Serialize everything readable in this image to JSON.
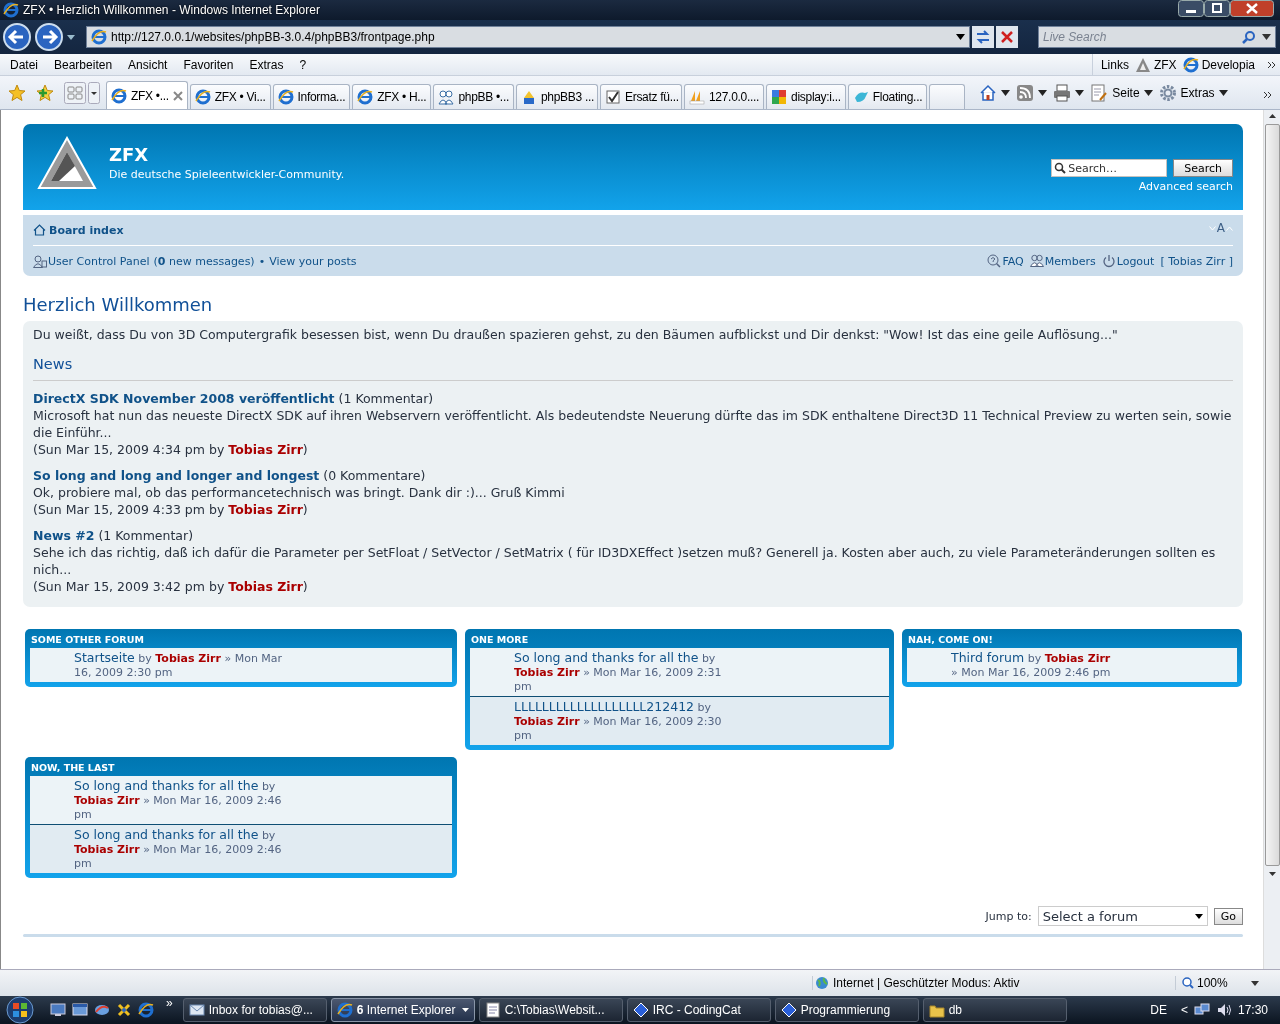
{
  "window": {
    "title": "ZFX • Herzlich Willkommen - Windows Internet Explorer"
  },
  "address": {
    "url": "http://127.0.0.1/websites/phpBB-3.0.4/phpBB3/frontpage.php"
  },
  "search": {
    "placeholder": "Live Search"
  },
  "menu": [
    "Datei",
    "Bearbeiten",
    "Ansicht",
    "Favoriten",
    "Extras",
    "?"
  ],
  "links_bar": {
    "label": "Links",
    "items": [
      {
        "kind": "zfx",
        "label": "ZFX"
      },
      {
        "kind": "ie",
        "label": "Developia"
      }
    ]
  },
  "tabs": [
    {
      "kind": "ie",
      "label": "ZFX •...",
      "selected": true
    },
    {
      "kind": "ie",
      "label": "ZFX • Vi...",
      "selected": false
    },
    {
      "kind": "ie",
      "label": "Informa...",
      "selected": false
    },
    {
      "kind": "ie",
      "label": "ZFX • H...",
      "selected": false
    },
    {
      "kind": "people",
      "label": "phpBB •...",
      "selected": false
    },
    {
      "kind": "hat",
      "label": "phpBB3 ...",
      "selected": false
    },
    {
      "kind": "check",
      "label": "Ersatz fü...",
      "selected": false
    },
    {
      "kind": "pma",
      "label": "127.0.0....",
      "selected": false
    },
    {
      "kind": "squares",
      "label": "display:i...",
      "selected": false
    },
    {
      "kind": "bird",
      "label": "Floating...",
      "selected": false
    }
  ],
  "commands": [
    {
      "kind": "home"
    },
    {
      "kind": "feeds"
    },
    {
      "kind": "print"
    },
    {
      "kind": "page",
      "label": "Seite"
    },
    {
      "kind": "tools",
      "label": "Extras"
    }
  ],
  "page": {
    "header": {
      "site": "ZFX",
      "tagline": "Die deutsche Spieleentwickler-Community.",
      "search_placeholder": "Search…",
      "search_button": "Search",
      "advanced": "Advanced search"
    },
    "nav": {
      "board_index": "Board index",
      "font_size": "A",
      "ucp": "User Control Panel",
      "messages": "(**0** new messages)",
      "separator": "•",
      "own_posts": "View your posts",
      "right": [
        {
          "kind": "faq",
          "label": "FAQ"
        },
        {
          "kind": "members",
          "label": "Members"
        },
        {
          "kind": "logout",
          "label": "Logout"
        }
      ],
      "user": "[ Tobias Zirr ]"
    },
    "title": "Herzlich Willkommen",
    "intro": "Du weißt, dass Du von 3D Computergrafik besessen bist, wenn Du draußen spazieren gehst, zu den Bäumen aufblickst und Dir denkst: \"Wow! Ist das eine geile Auflösung...\"",
    "news_heading": "News",
    "news": [
      {
        "title": "DirectX SDK November 2008 veröffentlicht",
        "comments": "(1 Kommentar)",
        "excerpt": "Microsoft hat nun das neueste DirectX SDK auf ihren Webservern veröffentlicht. Als bedeutendste Neuerung dürfte das im SDK enthaltene Direct3D 11 Technical Preview zu werten sein, sowie die Einführ...",
        "meta": "(Sun Mar 15, 2009 4:34 pm by **Tobias Zirr**)"
      },
      {
        "title": "So long and long and longer and longest",
        "comments": "(0 Kommentare)",
        "excerpt": "Ok, probiere mal, ob das performancetechnisch was bringt. Dank dir :)... Gruß Kimmi",
        "meta": "(Sun Mar 15, 2009 4:33 pm by **Tobias Zirr**)"
      },
      {
        "title": "News #2",
        "comments": "(1 Kommentar)",
        "excerpt": "Sehe ich das richtig, daß ich dafür die Parameter per SetFloat / SetVector / SetMatrix ( für ID3DXEffect )setzen muß? Generell ja. Kosten aber auch, zu viele Parameteränderungen sollten es nich...",
        "meta": "(Sun Mar 15, 2009 3:42 pm by **Tobias Zirr**)"
      }
    ],
    "forums": [
      {
        "name": "SOME OTHER FORUM",
        "topics": [
          {
            "title": "Startseite",
            "meta": "by **Tobias Zirr** » Mon Mar 16, 2009 2:30 pm"
          }
        ]
      },
      {
        "name": "ONE MORE",
        "topics": [
          {
            "title": "So long and thanks for all the",
            "meta": "by **Tobias Zirr** » Mon Mar 16, 2009 2:31 pm"
          },
          {
            "title": "LLLLLLLLLLLLLLLLLLL212412",
            "meta": "by **Tobias Zirr** » Mon Mar 16, 2009 2:30 pm"
          }
        ]
      },
      {
        "name": "NAH, COME ON!",
        "topics": [
          {
            "title": "Third forum",
            "meta": "by **Tobias Zirr** » Mon Mar 16, 2009 2:46 pm"
          }
        ]
      },
      {
        "name": "NOW, THE LAST",
        "topics": [
          {
            "title": "So long and thanks for all the",
            "meta": "by **Tobias Zirr** » Mon Mar 16, 2009 2:46 pm"
          },
          {
            "title": "So long and thanks for all the",
            "meta": "by **Tobias Zirr** » Mon Mar 16, 2009 2:46 pm"
          }
        ]
      }
    ],
    "jump": {
      "label": "Jump to:",
      "value": "Select a forum",
      "button": "Go"
    }
  },
  "status_bar": {
    "zone": "Internet | Geschützter Modus: Aktiv",
    "zoom": "100%"
  },
  "taskbar": {
    "quick_launch": "»",
    "tasks": [
      {
        "kind": "mail",
        "label": "Inbox for tobias@...",
        "selected": false
      },
      {
        "kind": "ie",
        "label": "**6** Internet Explorer",
        "selected": true
      },
      {
        "kind": "note",
        "label": "C:\\Tobias\\Websit...",
        "selected": false
      },
      {
        "kind": "diamond",
        "label": "IRC - CodingCat",
        "selected": false
      },
      {
        "kind": "diamond",
        "label": "Programmierung",
        "selected": false
      },
      {
        "kind": "folder",
        "label": "db",
        "selected": false
      }
    ],
    "language": "DE",
    "tray_arrow": "<",
    "time": "17:30"
  }
}
